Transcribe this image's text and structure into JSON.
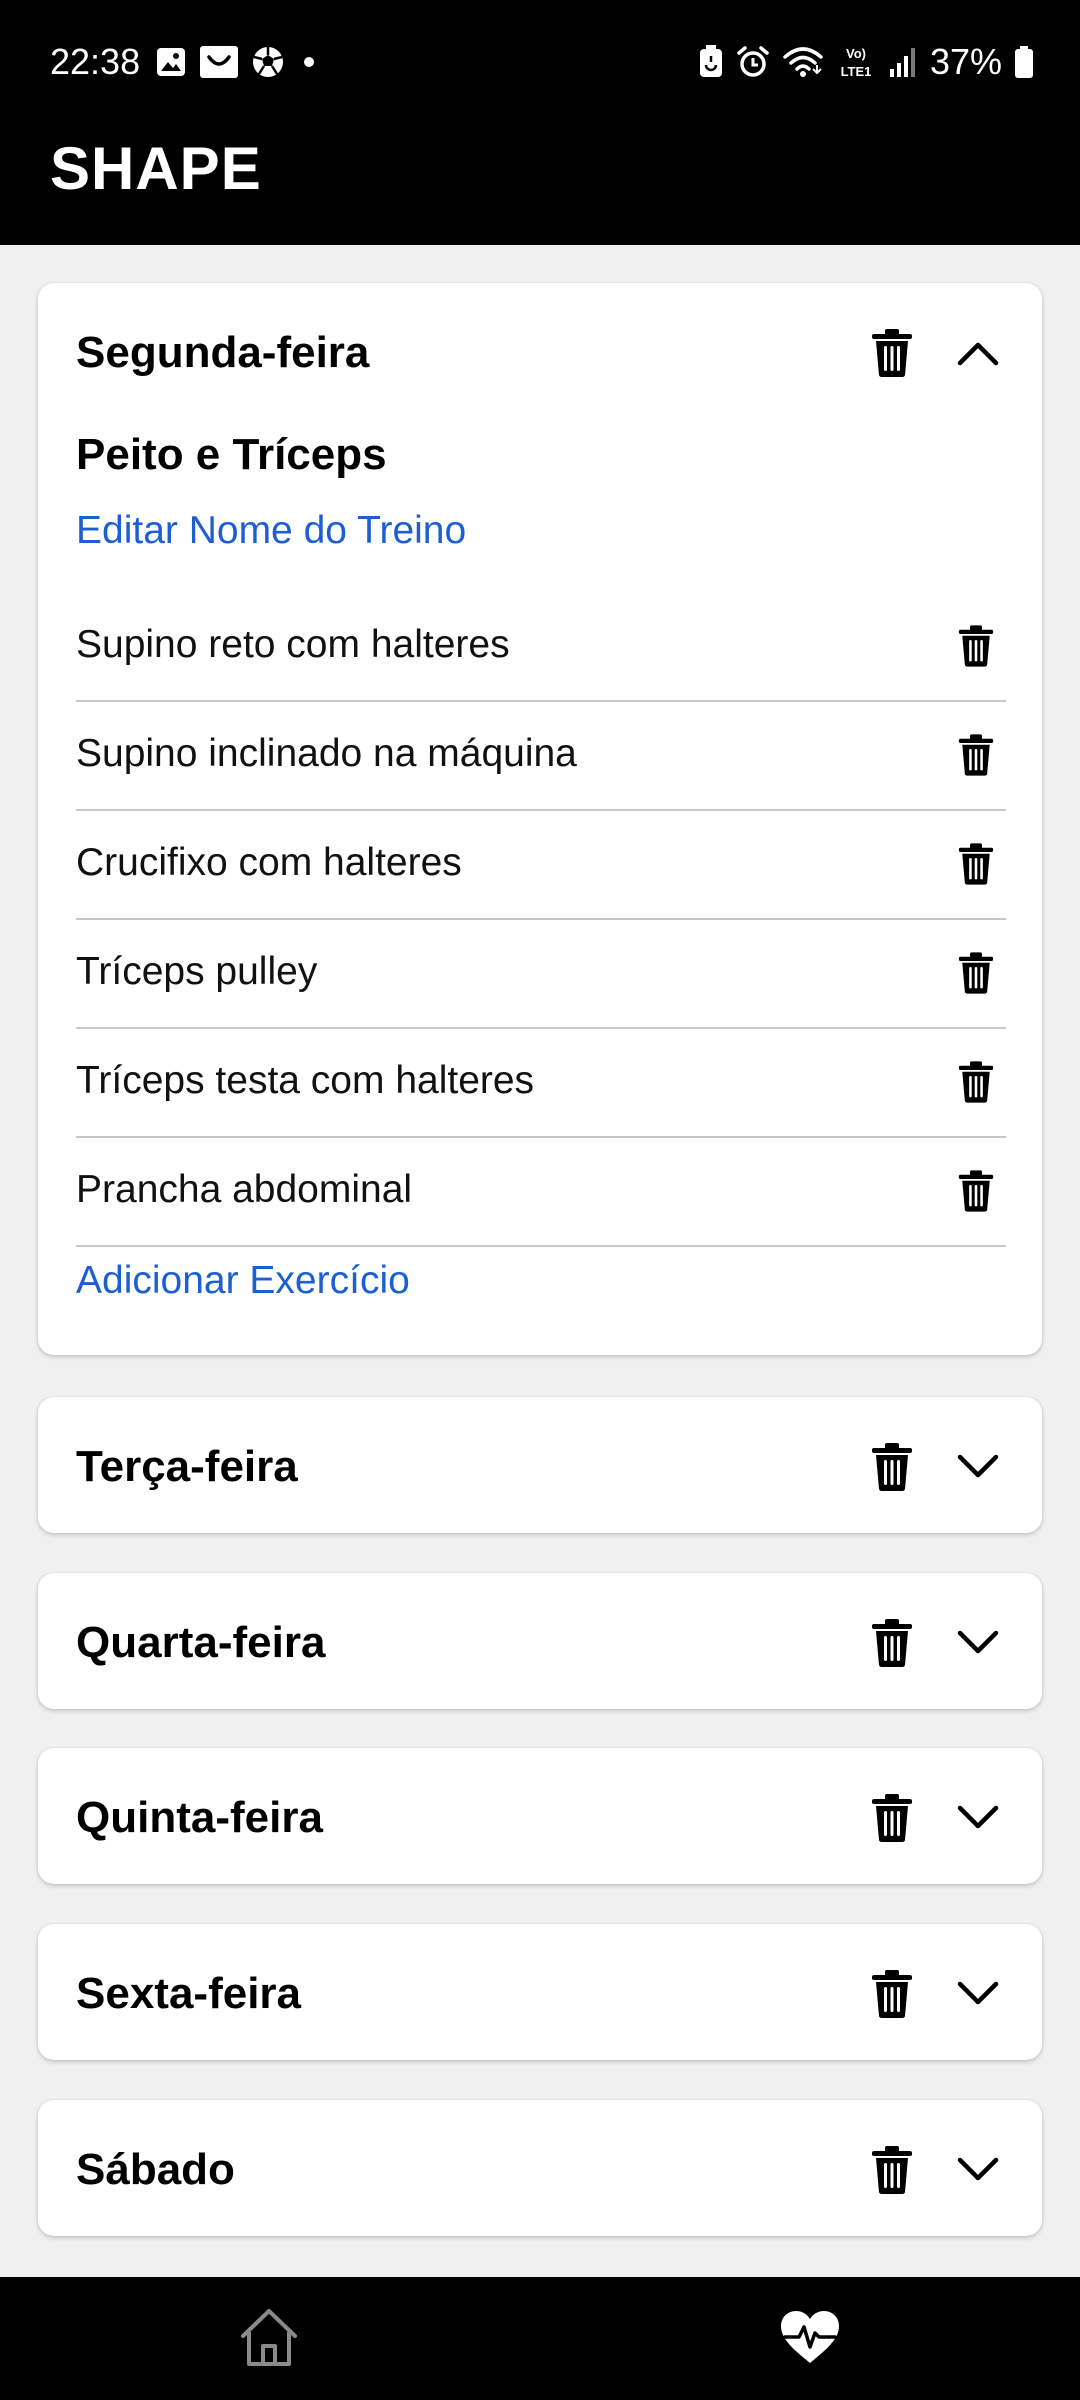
{
  "status_bar": {
    "time": "22:38",
    "battery": "37%",
    "network": "LTE1",
    "notification_icons": [
      "gallery-icon",
      "store-icon",
      "soccer-icon",
      "dot-icon"
    ],
    "system_icons": [
      "battery-saver-icon",
      "alarm-icon",
      "wifi-icon",
      "volte-icon",
      "signal-icon",
      "battery-icon"
    ]
  },
  "app": {
    "title": "SHAPE"
  },
  "days": [
    {
      "day": "Segunda-feira",
      "expanded": true,
      "workout_name": "Peito e Tríceps",
      "edit_label": "Editar Nome do Treino",
      "exercises": [
        "Supino reto com halteres",
        "Supino inclinado na máquina",
        "Crucifixo com halteres",
        "Tríceps pulley",
        "Tríceps testa com halteres",
        "Prancha abdominal"
      ],
      "add_label": "Adicionar Exercício"
    },
    {
      "day": "Terça-feira",
      "expanded": false
    },
    {
      "day": "Quarta-feira",
      "expanded": false
    },
    {
      "day": "Quinta-feira",
      "expanded": false
    },
    {
      "day": "Sexta-feira",
      "expanded": false
    },
    {
      "day": "Sábado",
      "expanded": false
    }
  ],
  "bottom_nav": {
    "items": [
      {
        "icon": "home-icon",
        "active": false
      },
      {
        "icon": "heart-pulse-icon",
        "active": true
      }
    ]
  },
  "colors": {
    "header_bg": "#000000",
    "page_bg": "#f0f0f0",
    "card_bg": "#ffffff",
    "link": "#1c5fd4",
    "divider": "#c8c8c8",
    "nav_inactive": "#8a8a8a",
    "nav_active": "#ffffff"
  }
}
